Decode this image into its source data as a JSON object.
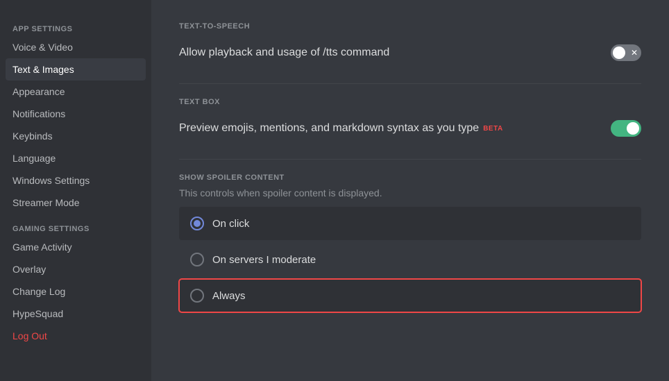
{
  "sidebar": {
    "app_settings_label": "APP SETTINGS",
    "gaming_settings_label": "GAMING SETTINGS",
    "items": [
      {
        "id": "voice-video",
        "label": "Voice & Video",
        "active": false
      },
      {
        "id": "text-images",
        "label": "Text & Images",
        "active": true
      },
      {
        "id": "appearance",
        "label": "Appearance",
        "active": false
      },
      {
        "id": "notifications",
        "label": "Notifications",
        "active": false
      },
      {
        "id": "keybinds",
        "label": "Keybinds",
        "active": false
      },
      {
        "id": "language",
        "label": "Language",
        "active": false
      },
      {
        "id": "windows-settings",
        "label": "Windows Settings",
        "active": false
      },
      {
        "id": "streamer-mode",
        "label": "Streamer Mode",
        "active": false
      },
      {
        "id": "game-activity",
        "label": "Game Activity",
        "active": false
      },
      {
        "id": "overlay",
        "label": "Overlay",
        "active": false
      },
      {
        "id": "change-log",
        "label": "Change Log",
        "active": false
      },
      {
        "id": "hypesquad",
        "label": "HypeSquad",
        "active": false
      },
      {
        "id": "log-out",
        "label": "Log Out",
        "active": false,
        "red": true
      }
    ]
  },
  "main": {
    "tts_section_label": "TEXT-TO-SPEECH",
    "tts_description": "Allow playback and usage of /tts command",
    "tts_enabled": false,
    "textbox_section_label": "TEXT BOX",
    "textbox_description": "Preview emojis, mentions, and markdown syntax as you type",
    "textbox_beta": "BETA",
    "textbox_enabled": true,
    "spoiler_section_label": "SHOW SPOILER CONTENT",
    "spoiler_description": "This controls when spoiler content is displayed.",
    "spoiler_options": [
      {
        "id": "on-click",
        "label": "On click",
        "selected": true,
        "highlighted": false
      },
      {
        "id": "on-servers",
        "label": "On servers I moderate",
        "selected": false,
        "highlighted": false
      },
      {
        "id": "always",
        "label": "Always",
        "selected": false,
        "highlighted": true
      }
    ]
  }
}
